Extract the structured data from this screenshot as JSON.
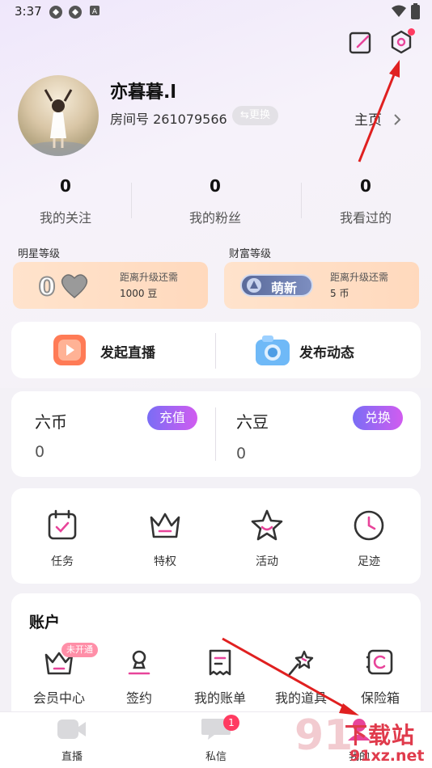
{
  "status_bar": {
    "time": "3:37"
  },
  "header": {
    "edit_icon": "edit-icon",
    "settings_icon": "settings-icon"
  },
  "profile": {
    "nickname": "亦暮暮.l",
    "room_label": "房间号 261079566",
    "swap_label": "⇆更换",
    "homepage_label": "主页"
  },
  "stats": [
    {
      "value": "0",
      "label": "我的关注"
    },
    {
      "value": "0",
      "label": "我的粉丝"
    },
    {
      "value": "0",
      "label": "我看过的"
    }
  ],
  "levels": {
    "star": {
      "title": "明星等级",
      "level_number": "0",
      "hint": "距离升级还需",
      "value": "1000 豆"
    },
    "wealth": {
      "title": "财富等级",
      "badge": "萌新",
      "hint": "距离升级还需",
      "value": "5 币"
    }
  },
  "actions": {
    "live_label": "发起直播",
    "post_label": "发布动态"
  },
  "wallet": {
    "coin_title": "六币",
    "coin_value": "0",
    "coin_button": "充值",
    "bean_title": "六豆",
    "bean_value": "0",
    "bean_button": "兑换"
  },
  "features": [
    {
      "label": "任务",
      "icon": "calendar-check-icon"
    },
    {
      "label": "特权",
      "icon": "crown-icon"
    },
    {
      "label": "活动",
      "icon": "star-icon"
    },
    {
      "label": "足迹",
      "icon": "clock-icon"
    }
  ],
  "account": {
    "title": "账户",
    "items": [
      {
        "label": "会员中心",
        "icon": "crown-icon",
        "badge": "未开通"
      },
      {
        "label": "签约",
        "icon": "stamp-icon"
      },
      {
        "label": "我的账单",
        "icon": "receipt-icon"
      },
      {
        "label": "我的道具",
        "icon": "magic-wand-icon"
      },
      {
        "label": "保险箱",
        "icon": "safe-icon"
      }
    ]
  },
  "bottom_nav": {
    "items": [
      {
        "label": "直播",
        "icon": "video-camera-icon"
      },
      {
        "label": "私信",
        "icon": "chat-icon",
        "badge": "1"
      },
      {
        "label": "我的",
        "icon": "user-icon"
      }
    ]
  },
  "watermark": {
    "brand": "下载站",
    "url": "91xz.net",
    "digits": "91"
  },
  "colors": {
    "accent_pink": "#e8449a",
    "badge_red": "#ff3b61",
    "pill_gradient_start": "#7a6df5",
    "pill_gradient_end": "#d15cf0",
    "arrow_red": "#e02020"
  }
}
